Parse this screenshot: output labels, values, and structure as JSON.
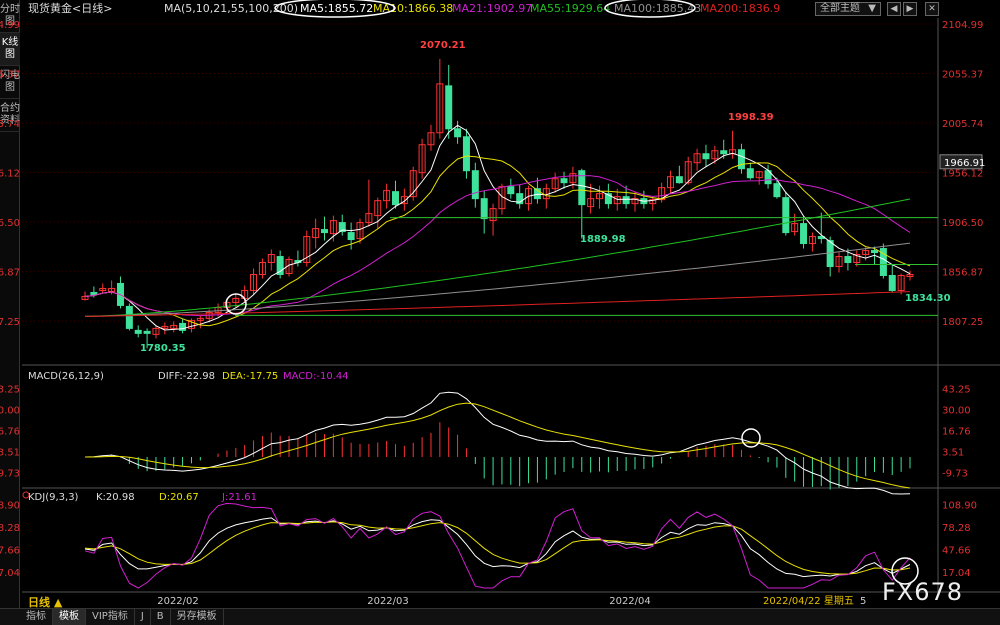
{
  "sidebar": {
    "tabs": [
      {
        "label": "分时图",
        "active": false
      },
      {
        "label": "K线图",
        "active": true
      },
      {
        "label": "闪电图",
        "active": false
      },
      {
        "label": "合约资料",
        "active": false
      }
    ]
  },
  "header": {
    "instrument": "现货黄金<日线>",
    "ma_params": "MA(5,10,21,55,100,200)",
    "ma_values": [
      {
        "text": "MA5:1855.72",
        "color": "#ffffff"
      },
      {
        "text": "MA10:1866.38",
        "color": "#e8e000"
      },
      {
        "text": "MA21:1902.97",
        "color": "#d020d0"
      },
      {
        "text": "MA55:1929.64",
        "color": "#20c020"
      },
      {
        "text": "MA100:1885.43",
        "color": "#909090"
      },
      {
        "text": "MA200:1836.9",
        "color": "#e02020"
      }
    ],
    "theme_button": "全部主题"
  },
  "colors": {
    "up": "#ff3232",
    "down": "#3ee29b",
    "text_red": "#e03030",
    "grid": "#3a0000",
    "highlight": "#ffffff"
  },
  "chart_data": {
    "type": "candlestick",
    "title": "现货黄金<日线>",
    "price_axis_ticks": [
      "2104.99",
      "2055.37",
      "2005.74",
      "1956.12",
      "1906.50",
      "1856.87",
      "1807.25"
    ],
    "price_range": [
      1780.35,
      2104.99
    ],
    "current_price_label": "1966.91",
    "annotations": [
      {
        "text": "2070.21",
        "type": "high"
      },
      {
        "text": "1998.39",
        "type": "high"
      },
      {
        "text": "1889.98",
        "type": "low"
      },
      {
        "text": "1780.35",
        "type": "low"
      },
      {
        "text": "1834.30",
        "type": "low"
      }
    ],
    "support_resistance": [
      1911,
      1813,
      1864
    ],
    "moving_averages": [
      "MA5",
      "MA10",
      "MA21",
      "MA55",
      "MA100",
      "MA200"
    ],
    "x_labels": [
      "2022/02",
      "2022/03",
      "2022/04"
    ],
    "crosshair_label": "2022/04/22 星期五",
    "crosshair_tail": "5",
    "candles": [
      {
        "o": 1829,
        "h": 1837,
        "l": 1828,
        "c": 1832
      },
      {
        "o": 1836,
        "h": 1842,
        "l": 1831,
        "c": 1834
      },
      {
        "o": 1838,
        "h": 1845,
        "l": 1835,
        "c": 1840
      },
      {
        "o": 1837,
        "h": 1848,
        "l": 1834,
        "c": 1840
      },
      {
        "o": 1845,
        "h": 1852,
        "l": 1820,
        "c": 1823
      },
      {
        "o": 1822,
        "h": 1825,
        "l": 1798,
        "c": 1800
      },
      {
        "o": 1798,
        "h": 1803,
        "l": 1791,
        "c": 1795
      },
      {
        "o": 1797,
        "h": 1800,
        "l": 1780,
        "c": 1795
      },
      {
        "o": 1794,
        "h": 1803,
        "l": 1790,
        "c": 1800
      },
      {
        "o": 1800,
        "h": 1806,
        "l": 1794,
        "c": 1802
      },
      {
        "o": 1800,
        "h": 1807,
        "l": 1796,
        "c": 1803
      },
      {
        "o": 1805,
        "h": 1810,
        "l": 1795,
        "c": 1798
      },
      {
        "o": 1800,
        "h": 1810,
        "l": 1796,
        "c": 1808
      },
      {
        "o": 1808,
        "h": 1813,
        "l": 1800,
        "c": 1810
      },
      {
        "o": 1810,
        "h": 1819,
        "l": 1806,
        "c": 1816
      },
      {
        "o": 1816,
        "h": 1825,
        "l": 1812,
        "c": 1821
      },
      {
        "o": 1821,
        "h": 1830,
        "l": 1817,
        "c": 1826
      },
      {
        "o": 1826,
        "h": 1834,
        "l": 1821,
        "c": 1830
      },
      {
        "o": 1830,
        "h": 1843,
        "l": 1826,
        "c": 1838
      },
      {
        "o": 1838,
        "h": 1860,
        "l": 1834,
        "c": 1854
      },
      {
        "o": 1854,
        "h": 1870,
        "l": 1850,
        "c": 1866
      },
      {
        "o": 1866,
        "h": 1879,
        "l": 1858,
        "c": 1874
      },
      {
        "o": 1872,
        "h": 1878,
        "l": 1850,
        "c": 1854
      },
      {
        "o": 1855,
        "h": 1872,
        "l": 1852,
        "c": 1869
      },
      {
        "o": 1868,
        "h": 1878,
        "l": 1862,
        "c": 1866
      },
      {
        "o": 1866,
        "h": 1898,
        "l": 1862,
        "c": 1892
      },
      {
        "o": 1891,
        "h": 1910,
        "l": 1880,
        "c": 1900
      },
      {
        "o": 1899,
        "h": 1912,
        "l": 1888,
        "c": 1896
      },
      {
        "o": 1895,
        "h": 1913,
        "l": 1887,
        "c": 1908
      },
      {
        "o": 1906,
        "h": 1914,
        "l": 1893,
        "c": 1897
      },
      {
        "o": 1896,
        "h": 1906,
        "l": 1879,
        "c": 1889
      },
      {
        "o": 1890,
        "h": 1910,
        "l": 1885,
        "c": 1906
      },
      {
        "o": 1906,
        "h": 1949,
        "l": 1902,
        "c": 1915
      },
      {
        "o": 1913,
        "h": 1931,
        "l": 1900,
        "c": 1928
      },
      {
        "o": 1928,
        "h": 1945,
        "l": 1920,
        "c": 1938
      },
      {
        "o": 1937,
        "h": 1948,
        "l": 1920,
        "c": 1924
      },
      {
        "o": 1925,
        "h": 1940,
        "l": 1918,
        "c": 1932
      },
      {
        "o": 1932,
        "h": 1962,
        "l": 1928,
        "c": 1958
      },
      {
        "o": 1956,
        "h": 1990,
        "l": 1950,
        "c": 1984
      },
      {
        "o": 1984,
        "h": 2004,
        "l": 1978,
        "c": 1996
      },
      {
        "o": 1996,
        "h": 2070,
        "l": 1990,
        "c": 2045
      },
      {
        "o": 2043,
        "h": 2064,
        "l": 1990,
        "c": 2000
      },
      {
        "o": 2000,
        "h": 2008,
        "l": 1985,
        "c": 1992
      },
      {
        "o": 1992,
        "h": 2000,
        "l": 1950,
        "c": 1958
      },
      {
        "o": 1958,
        "h": 1966,
        "l": 1921,
        "c": 1930
      },
      {
        "o": 1930,
        "h": 1938,
        "l": 1895,
        "c": 1910
      },
      {
        "o": 1908,
        "h": 1925,
        "l": 1893,
        "c": 1920
      },
      {
        "o": 1920,
        "h": 1945,
        "l": 1914,
        "c": 1942
      },
      {
        "o": 1942,
        "h": 1950,
        "l": 1930,
        "c": 1935
      },
      {
        "o": 1935,
        "h": 1944,
        "l": 1920,
        "c": 1925
      },
      {
        "o": 1925,
        "h": 1943,
        "l": 1918,
        "c": 1940
      },
      {
        "o": 1940,
        "h": 1951,
        "l": 1925,
        "c": 1930
      },
      {
        "o": 1930,
        "h": 1945,
        "l": 1920,
        "c": 1940
      },
      {
        "o": 1940,
        "h": 1956,
        "l": 1936,
        "c": 1950
      },
      {
        "o": 1950,
        "h": 1957,
        "l": 1940,
        "c": 1946
      },
      {
        "o": 1946,
        "h": 1962,
        "l": 1940,
        "c": 1955
      },
      {
        "o": 1958,
        "h": 1960,
        "l": 1890,
        "c": 1924
      },
      {
        "o": 1922,
        "h": 1945,
        "l": 1915,
        "c": 1930
      },
      {
        "o": 1930,
        "h": 1943,
        "l": 1920,
        "c": 1935
      },
      {
        "o": 1935,
        "h": 1945,
        "l": 1920,
        "c": 1925
      },
      {
        "o": 1925,
        "h": 1940,
        "l": 1918,
        "c": 1932
      },
      {
        "o": 1932,
        "h": 1943,
        "l": 1920,
        "c": 1925
      },
      {
        "o": 1925,
        "h": 1937,
        "l": 1917,
        "c": 1930
      },
      {
        "o": 1930,
        "h": 1938,
        "l": 1920,
        "c": 1925
      },
      {
        "o": 1925,
        "h": 1932,
        "l": 1918,
        "c": 1929
      },
      {
        "o": 1929,
        "h": 1946,
        "l": 1926,
        "c": 1941
      },
      {
        "o": 1941,
        "h": 1958,
        "l": 1935,
        "c": 1952
      },
      {
        "o": 1952,
        "h": 1963,
        "l": 1945,
        "c": 1946
      },
      {
        "o": 1946,
        "h": 1972,
        "l": 1944,
        "c": 1967
      },
      {
        "o": 1966,
        "h": 1980,
        "l": 1958,
        "c": 1975
      },
      {
        "o": 1975,
        "h": 1984,
        "l": 1962,
        "c": 1970
      },
      {
        "o": 1970,
        "h": 1983,
        "l": 1965,
        "c": 1978
      },
      {
        "o": 1978,
        "h": 1989,
        "l": 1970,
        "c": 1975
      },
      {
        "o": 1975,
        "h": 1998,
        "l": 1970,
        "c": 1979
      },
      {
        "o": 1979,
        "h": 1985,
        "l": 1955,
        "c": 1960
      },
      {
        "o": 1960,
        "h": 1966,
        "l": 1949,
        "c": 1951
      },
      {
        "o": 1951,
        "h": 1958,
        "l": 1944,
        "c": 1957
      },
      {
        "o": 1958,
        "h": 1964,
        "l": 1940,
        "c": 1945
      },
      {
        "o": 1945,
        "h": 1951,
        "l": 1930,
        "c": 1932
      },
      {
        "o": 1931,
        "h": 1937,
        "l": 1893,
        "c": 1896
      },
      {
        "o": 1897,
        "h": 1915,
        "l": 1893,
        "c": 1905
      },
      {
        "o": 1905,
        "h": 1912,
        "l": 1880,
        "c": 1885
      },
      {
        "o": 1885,
        "h": 1896,
        "l": 1877,
        "c": 1892
      },
      {
        "o": 1892,
        "h": 1916,
        "l": 1885,
        "c": 1890
      },
      {
        "o": 1888,
        "h": 1892,
        "l": 1852,
        "c": 1862
      },
      {
        "o": 1862,
        "h": 1876,
        "l": 1856,
        "c": 1872
      },
      {
        "o": 1872,
        "h": 1880,
        "l": 1858,
        "c": 1866
      },
      {
        "o": 1866,
        "h": 1878,
        "l": 1862,
        "c": 1874
      },
      {
        "o": 1874,
        "h": 1881,
        "l": 1868,
        "c": 1878
      },
      {
        "o": 1878,
        "h": 1882,
        "l": 1864,
        "c": 1876
      },
      {
        "o": 1880,
        "h": 1885,
        "l": 1850,
        "c": 1853
      },
      {
        "o": 1853,
        "h": 1864,
        "l": 1836,
        "c": 1838
      },
      {
        "o": 1838,
        "h": 1855,
        "l": 1834,
        "c": 1853
      },
      {
        "o": 1852,
        "h": 1858,
        "l": 1848,
        "c": 1854
      }
    ],
    "macd": {
      "params": "MACD(26,12,9)",
      "diff": "DIFF:-22.98",
      "dea": "DEA:-17.75",
      "macd": "MACD:-10.44",
      "ticks": [
        "43.25",
        "30.00",
        "16.76",
        "3.51",
        "-9.73"
      ],
      "range": [
        -17,
        46
      ]
    },
    "kdj": {
      "params": "KDJ(9,3,3)",
      "k": "K:20.98",
      "d": "D:20.67",
      "j": "J:21.61",
      "ticks": [
        "108.90",
        "78.28",
        "47.66",
        "17.04"
      ],
      "range": [
        -5,
        115
      ]
    }
  },
  "bottom_bar": {
    "period_label": "日线 ▲",
    "tabs": [
      {
        "label": "指标",
        "active": false
      },
      {
        "label": "模板",
        "active": true
      },
      {
        "label": "VIP指标",
        "active": false
      },
      {
        "label": "J",
        "active": false
      },
      {
        "label": "B",
        "active": false
      },
      {
        "label": "另存模板",
        "active": false
      }
    ]
  },
  "watermark": "FX678"
}
